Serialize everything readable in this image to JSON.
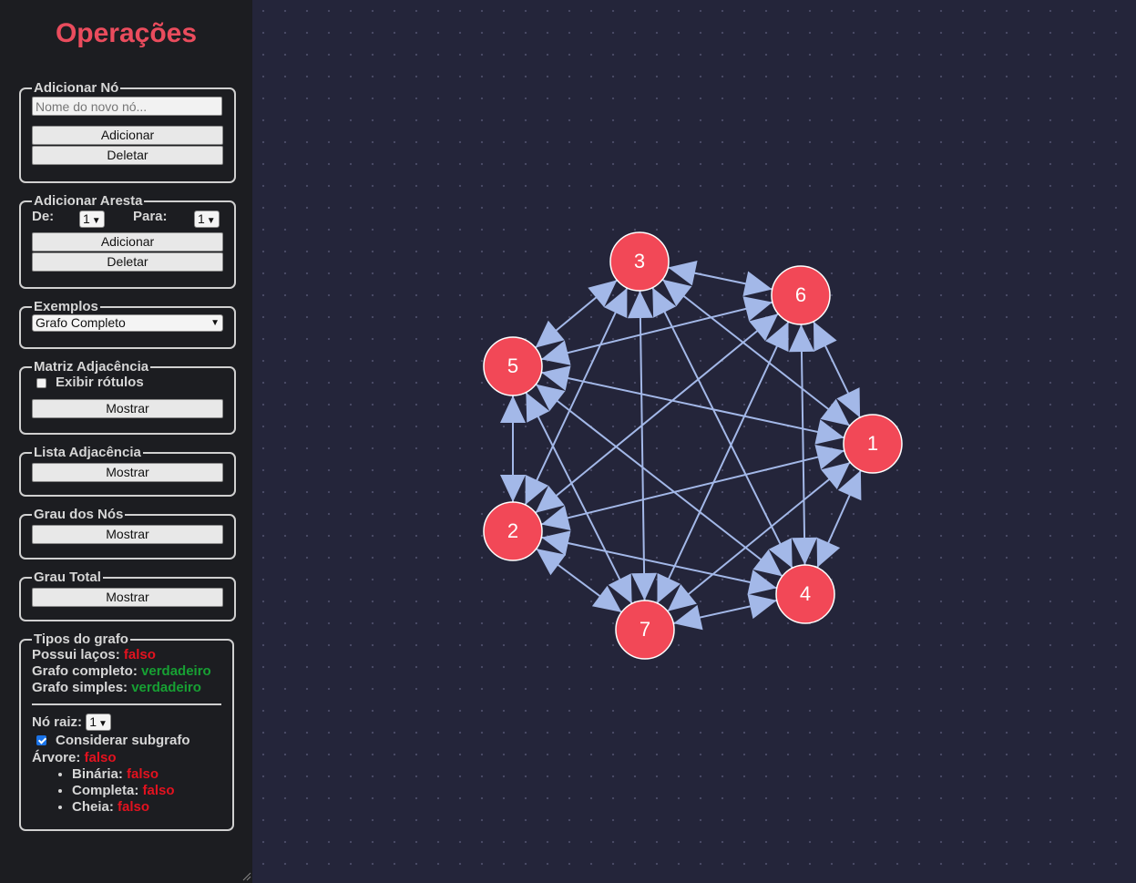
{
  "sidebar": {
    "title": "Operações",
    "add_node": {
      "legend": "Adicionar Nó",
      "placeholder": "Nome do novo nó...",
      "add_label": "Adicionar",
      "delete_label": "Deletar"
    },
    "add_edge": {
      "legend": "Adicionar Aresta",
      "from_label": "De:",
      "from_value": "1",
      "to_label": "Para:",
      "to_value": "1",
      "add_label": "Adicionar",
      "delete_label": "Deletar"
    },
    "examples": {
      "legend": "Exemplos",
      "selected": "Grafo Completo"
    },
    "adj_matrix": {
      "legend": "Matriz Adjacência",
      "show_labels_label": "Exibir rótulos",
      "show_labels_checked": false,
      "show_label": "Mostrar"
    },
    "adj_list": {
      "legend": "Lista Adjacência",
      "show_label": "Mostrar"
    },
    "node_degree": {
      "legend": "Grau dos Nós",
      "show_label": "Mostrar"
    },
    "total_degree": {
      "legend": "Grau Total",
      "show_label": "Mostrar"
    },
    "graph_types": {
      "legend": "Tipos do grafo",
      "has_loops_label": "Possui laços:",
      "has_loops_value": "falso",
      "complete_label": "Grafo completo:",
      "complete_value": "verdadeiro",
      "simple_label": "Grafo simples:",
      "simple_value": "verdadeiro",
      "root_label": "Nó raiz:",
      "root_value": "1",
      "subgraph_label": "Considerar subgrafo",
      "subgraph_checked": true,
      "tree_label": "Árvore:",
      "tree_value": "falso",
      "binary_label": "Binária:",
      "binary_value": "falso",
      "complete_tree_label": "Completa:",
      "complete_tree_value": "falso",
      "full_label": "Cheia:",
      "full_value": "falso"
    }
  },
  "graph": {
    "node_color": "#f24857",
    "edge_color": "#a3b8e8",
    "nodes": [
      "1",
      "2",
      "3",
      "4",
      "5",
      "6",
      "7"
    ],
    "directed": true,
    "complete": true
  }
}
